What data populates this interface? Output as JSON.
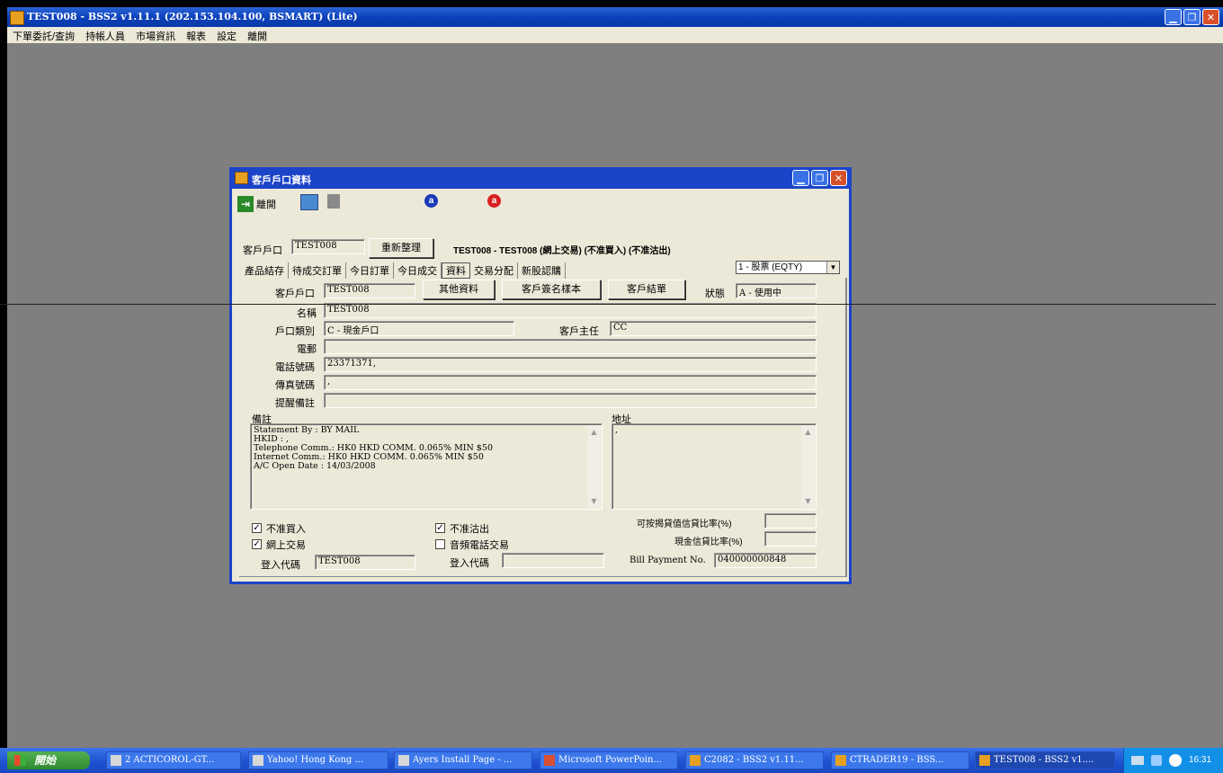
{
  "main_window": {
    "title": "TEST008 - BSS2 v1.11.1 (202.153.104.100, BSMART) (Lite)",
    "menu": [
      "下單委託/查詢",
      "持帳人員",
      "市場資訊",
      "報表",
      "設定",
      "離開"
    ]
  },
  "dialog": {
    "title": "客戶戶口資料",
    "toolbar": {
      "exit_label": "離開"
    },
    "account_label": "客戶戶口",
    "account_value": "TEST008",
    "refresh_button": "重新整理",
    "header_info": "TEST008 - TEST008 (網上交易) (不准買入) (不准沽出)",
    "market_select": "1 - 股票 (EQTY)",
    "tabs": [
      "產品結存",
      "待成交訂單",
      "今日訂單",
      "今日成交",
      "資料",
      "交易分配",
      "新股認購"
    ],
    "active_tab": "資料",
    "form": {
      "client_account_label": "客戶戶口",
      "client_account_value": "TEST008",
      "other_info_button": "其他資料",
      "signature_button": "客戶簽名樣本",
      "client_ledger_button": "客戶結單",
      "status_label": "狀態",
      "status_value": "A - 使用中",
      "name_label": "名稱",
      "name_value": "TEST008",
      "account_type_label": "戶口類別",
      "account_type_value": "C - 現金戶口",
      "ae_label": "客戶主任",
      "ae_value": "CC",
      "email_label": "電郵",
      "email_value": "",
      "phone_label": "電話號碼",
      "phone_value": "23371371,",
      "fax_label": "傳真號碼",
      "fax_value": ",",
      "reminder_label": "提醒備註",
      "reminder_value": "",
      "remarks_label": "備註",
      "remarks_lines": [
        "Statement By : BY MAIL",
        "HKID : ,",
        "Telephone Comm.: HK0 HKD COMM. 0.065% MIN $50",
        "Internet Comm.: HK0 HKD COMM. 0.065% MIN $50",
        "A/C Open Date : 14/03/2008"
      ],
      "address_label": "地址",
      "address_value": ",",
      "no_buy_label": "不准買入",
      "no_buy_checked": true,
      "online_trading_label": "網上交易",
      "online_trading_checked": true,
      "no_sell_label": "不准沽出",
      "no_sell_checked": true,
      "phone_trading_label": "音頻電話交易",
      "phone_trading_checked": false,
      "login_code_label_1": "登入代碼",
      "login_code_value_1": "TEST008",
      "login_code_label_2": "登入代碼",
      "login_code_value_2": "",
      "margin_ratio_label": "可按揭貸值信貸比率(%)",
      "margin_ratio_value": "",
      "cash_ratio_label": "現金信貸比率(%)",
      "cash_ratio_value": "",
      "bill_payment_label": "Bill Payment No.",
      "bill_payment_value": "040000000848"
    }
  },
  "taskbar": {
    "start_label": "開始",
    "tasks": [
      "2 ACTICOROL-GT...",
      "Yahoo! Hong Kong ...",
      "Ayers Install Page - ...",
      "Microsoft PowerPoin...",
      "C2082 - BSS2 v1.11...",
      "CTRADER19 - BSS...",
      "TEST008 - BSS2 v1...."
    ],
    "clock": "16:31"
  }
}
